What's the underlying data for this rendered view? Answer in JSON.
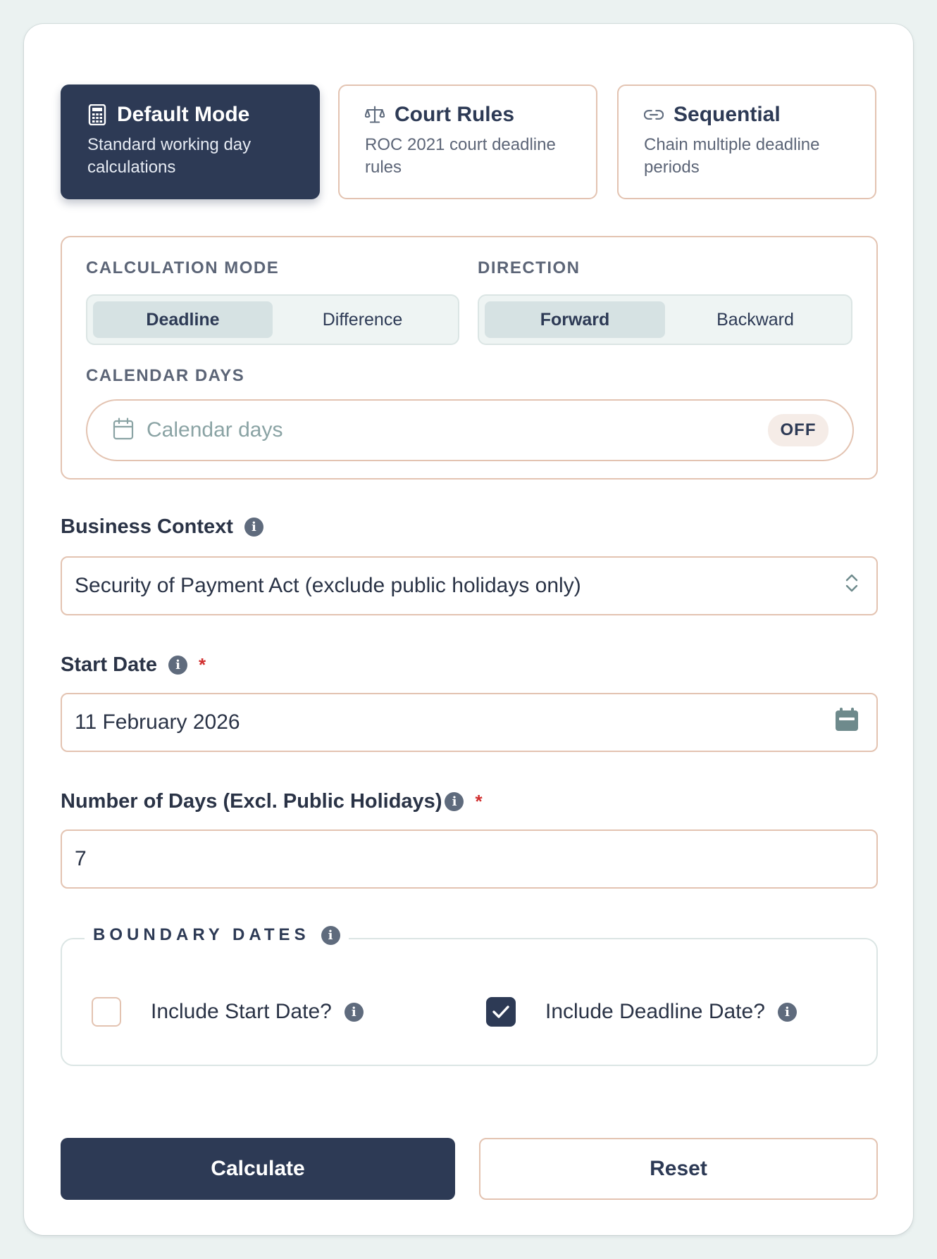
{
  "modes": [
    {
      "icon": "calculator-icon",
      "title": "Default Mode",
      "description": "Standard working day calculations",
      "active": true
    },
    {
      "icon": "scales-icon",
      "title": "Court Rules",
      "description": "ROC 2021 court deadline rules",
      "active": false
    },
    {
      "icon": "link-icon",
      "title": "Sequential",
      "description": "Chain multiple deadline periods",
      "active": false
    }
  ],
  "calculation_mode": {
    "label": "CALCULATION MODE",
    "options": [
      "Deadline",
      "Difference"
    ],
    "selected": "Deadline"
  },
  "direction": {
    "label": "DIRECTION",
    "options": [
      "Forward",
      "Backward"
    ],
    "selected": "Forward"
  },
  "calendar_days": {
    "label": "CALENDAR DAYS",
    "placeholder": "Calendar days",
    "state": "OFF"
  },
  "business_context": {
    "label": "Business Context",
    "value": "Security of Payment Act (exclude public holidays only)"
  },
  "start_date": {
    "label": "Start Date",
    "required_mark": "*",
    "value": "11 February 2026"
  },
  "number_of_days": {
    "label": "Number of Days (Excl. Public Holidays)",
    "required_mark": "*",
    "value": "7"
  },
  "boundary_dates": {
    "legend": "BOUNDARY DATES",
    "include_start": {
      "label": "Include Start Date?",
      "checked": false
    },
    "include_deadline": {
      "label": "Include Deadline Date?",
      "checked": true
    }
  },
  "actions": {
    "calculate": "Calculate",
    "reset": "Reset"
  },
  "colors": {
    "primary": "#2d3a55",
    "border": "#e3c3b1",
    "background": "#ebf2f1",
    "required": "#d12f2f"
  }
}
